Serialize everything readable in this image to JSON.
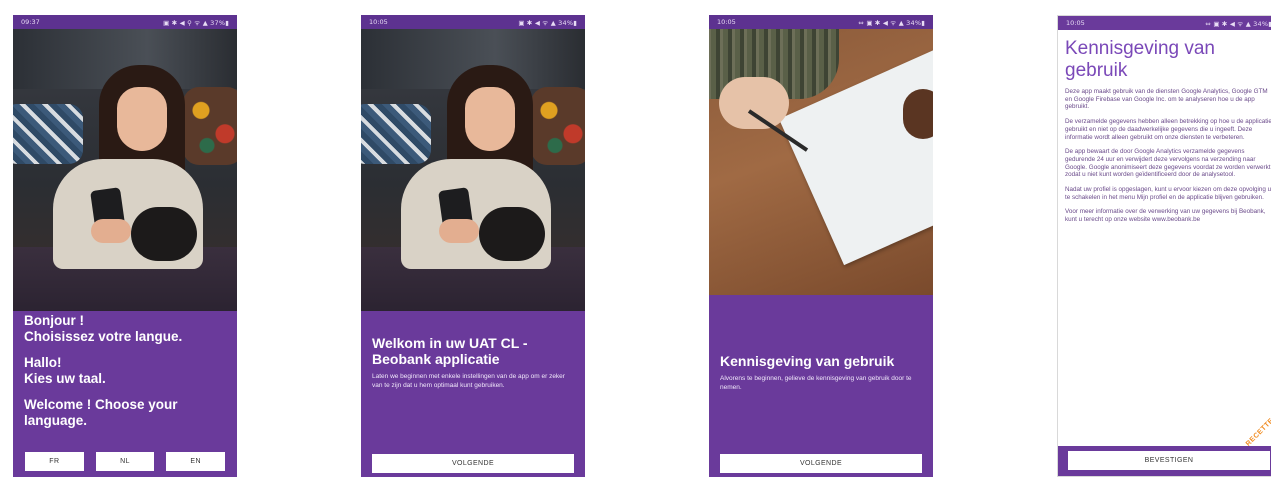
{
  "screens": [
    {
      "status": {
        "time": "09:37",
        "right": "▣ ✱ ◀ ⚲ ᯤ ▲ 37%▮"
      },
      "messages": [
        "Bonjour !\nChoisissez votre langue.",
        "Hallo!\nKies uw taal.",
        "Welcome ! Choose your\nlanguage."
      ],
      "buttons": [
        "FR",
        "NL",
        "EN"
      ]
    },
    {
      "status": {
        "time": "10:05",
        "right": "▣ ✱ ◀ ᯤ ▲ 34%▮"
      },
      "title": "Welkom in uw UAT CL - Beobank applicatie",
      "body": "Laten we beginnen met enkele instellingen van de app om er zeker van te zijn dat u hem optimaal kunt gebruiken.",
      "button": "VOLGENDE"
    },
    {
      "status": {
        "time": "10:05",
        "right": "⇔ ▣ ✱ ◀ ᯤ ▲ 34%▮"
      },
      "title": "Kennisgeving van gebruik",
      "body": "Alvorens te beginnen, gelieve de kennisgeving van gebruik door te nemen.",
      "button": "VOLGENDE"
    },
    {
      "status": {
        "time": "10:05",
        "right": "⇔ ▣ ✱ ◀ ᯤ ▲ 34%▮"
      },
      "title": "Kennisgeving van gebruik",
      "paragraphs": [
        "Deze app maakt gebruik van de diensten Google Analytics, Google GTM en Google Firebase van Google Inc. om te analyseren hoe u de app gebruikt.",
        "De verzamelde gegevens hebben alleen betrekking op hoe u de applicatie gebruikt en niet op de daadwerkelijke gegevens die u ingeeft. Deze informatie wordt alleen gebruikt om onze diensten te verbeteren.",
        "De app bewaart de door Google Analytics verzamelde gegevens gedurende 24 uur en verwijdert deze vervolgens na verzending naar Google. Google anonimiseert deze gegevens voordat ze worden verwerkt, zodat u niet kunt worden geïdentificeerd door de analysetool.",
        "Nadat uw profiel is opgeslagen, kunt u ervoor kiezen om deze opvolging uit te schakelen in het menu Mijn profiel en de applicatie blijven gebruiken.",
        "Voor meer informatie over de verwerking van uw gegevens bij Beobank, kunt u terecht op onze website www.beobank.be"
      ],
      "badge": "RECETTE",
      "button": "BEVESTIGEN"
    }
  ],
  "colors": {
    "purple": "#6a3a9b",
    "title_purple": "#7a48b8",
    "badge_orange": "#f08a1e"
  }
}
